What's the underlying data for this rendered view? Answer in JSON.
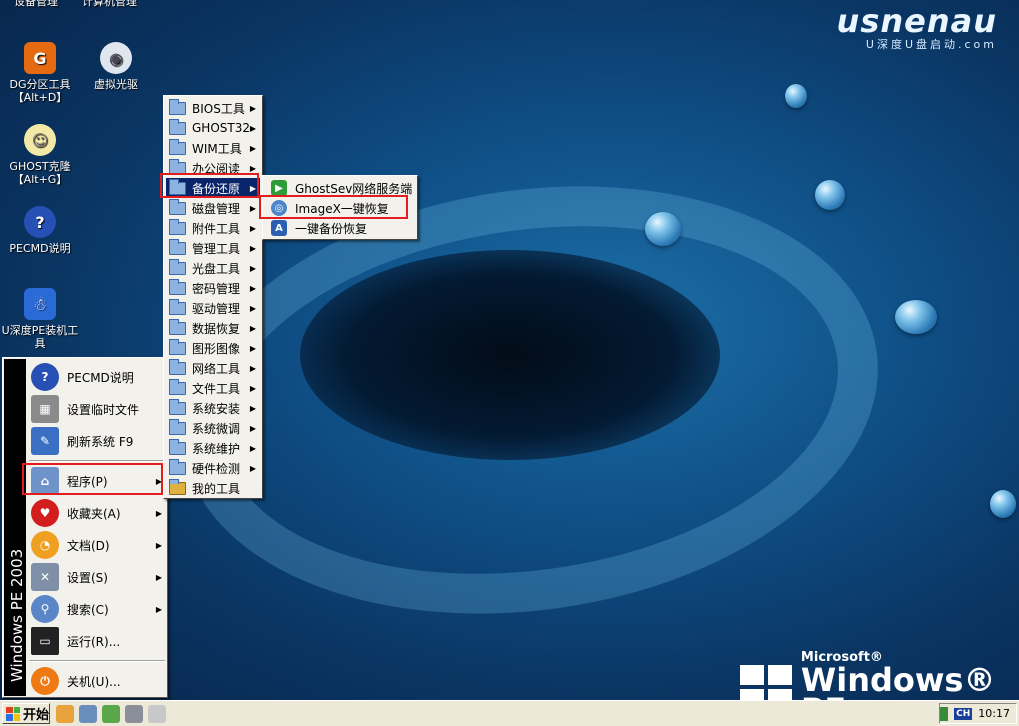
{
  "brand": {
    "name": "usnenau",
    "tagline": "U深度U盘启动.com"
  },
  "os_logo": {
    "microsoft": "Microsoft®",
    "product": "Windows® PE"
  },
  "desktop_icons": [
    {
      "label": "DG分区工具【Alt+D】",
      "icon": "partition-icon"
    },
    {
      "label": "虚拟光驱",
      "icon": "virtual-drive-icon"
    },
    {
      "label": "GHOST克隆【Alt+G】",
      "icon": "ghost-icon"
    },
    {
      "label": "PECMD说明",
      "icon": "help-icon"
    },
    {
      "label": "U深度PE装机工具",
      "icon": "installer-icon"
    }
  ],
  "start_menu": {
    "banner": "Windows PE 2003",
    "items": [
      {
        "label": "PECMD说明",
        "icon": "help-icon"
      },
      {
        "label": "设置临时文件",
        "icon": "chip-icon"
      },
      {
        "label": "刷新系统 F9",
        "icon": "refresh-icon"
      },
      {
        "label": "程序(P)",
        "icon": "programs-icon"
      },
      {
        "label": "收藏夹(A)",
        "icon": "heart-icon"
      },
      {
        "label": "文档(D)",
        "icon": "document-icon"
      },
      {
        "label": "设置(S)",
        "icon": "settings-icon"
      },
      {
        "label": "搜索(C)",
        "icon": "search-icon"
      },
      {
        "label": "运行(R)...",
        "icon": "run-icon"
      },
      {
        "label": "关机(U)...",
        "icon": "shutdown-icon"
      }
    ]
  },
  "programs_menu": [
    "BIOS工具",
    "GHOST32",
    "WIM工具",
    "办公阅读",
    "备份还原",
    "磁盘管理",
    "附件工具",
    "管理工具",
    "光盘工具",
    "密码管理",
    "驱动管理",
    "数据恢复",
    "图形图像",
    "网络工具",
    "文件工具",
    "系统安装",
    "系统微调",
    "系统维护",
    "硬件检测",
    "我的工具"
  ],
  "backup_menu": [
    {
      "label": "GhostSev网络服务端",
      "icon": "ghost-server-icon"
    },
    {
      "label": "ImageX一键恢复",
      "icon": "imagex-icon"
    },
    {
      "label": "一键备份恢复",
      "icon": "backup-icon"
    }
  ],
  "taskbar": {
    "start_label": "开始",
    "tray_lang": "CH",
    "clock": "10:17"
  },
  "top_cut_labels": [
    "设备管理",
    "计算机管理"
  ]
}
